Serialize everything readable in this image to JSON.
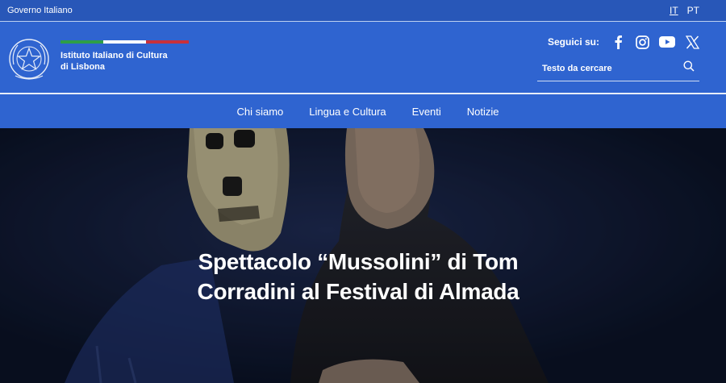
{
  "topbar": {
    "gov_label": "Governo Italiano",
    "languages": [
      "IT",
      "PT"
    ]
  },
  "header": {
    "institute_name": "Istituto Italiano di Cultura di Lisbona",
    "tricolor": [
      "#2e9e48",
      "#ffffff",
      "#c8313a"
    ],
    "social_label": "Seguici su:",
    "social_icons": [
      "facebook-icon",
      "instagram-icon",
      "youtube-icon",
      "x-icon"
    ],
    "search_placeholder": "Testo da cercare"
  },
  "nav": {
    "items": [
      "Chi siamo",
      "Lingua e Cultura",
      "Eventi",
      "Notizie"
    ]
  },
  "hero": {
    "title": "Spettacolo “Mussolini” di Tom Corradini al Festival di Almada"
  },
  "colors": {
    "topbar": "#2857b8",
    "header": "#2f64d0"
  }
}
